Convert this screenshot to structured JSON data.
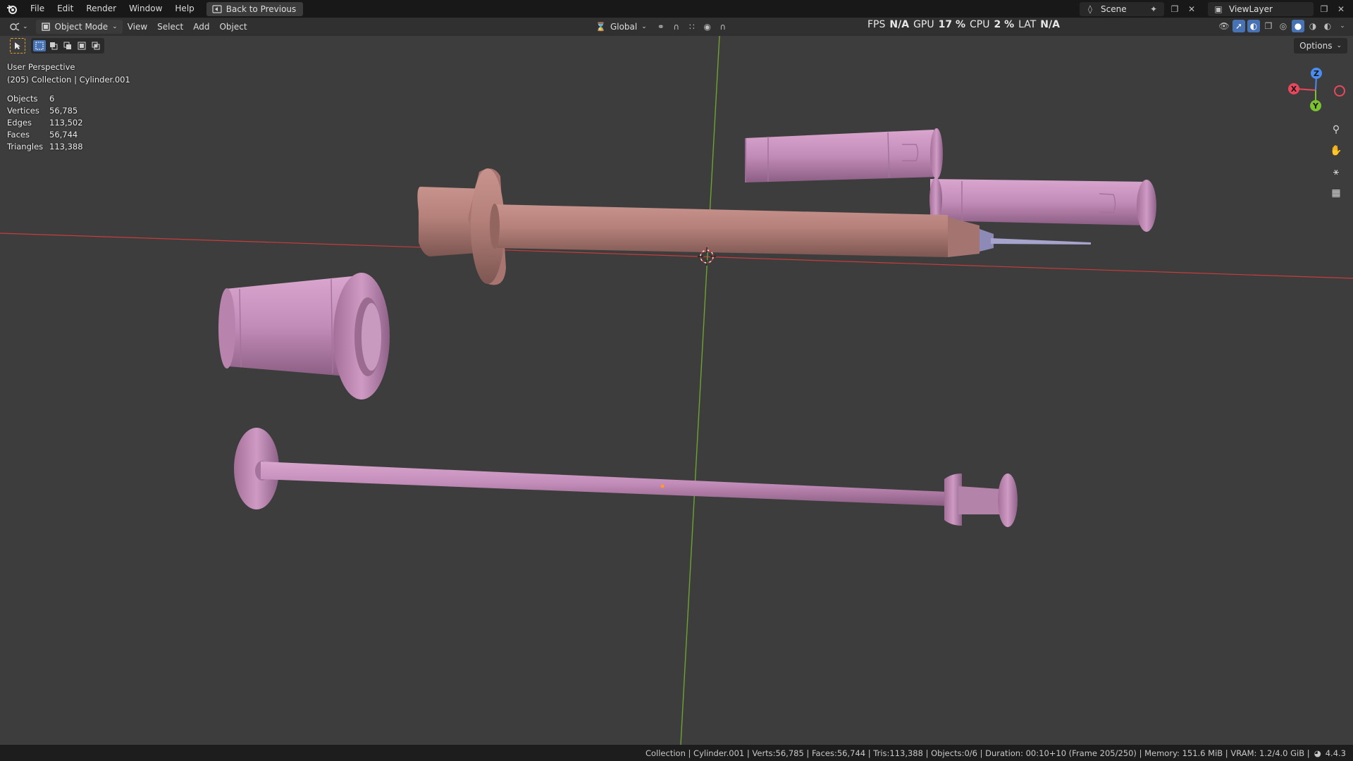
{
  "menubar": {
    "items": [
      "File",
      "Edit",
      "Render",
      "Window",
      "Help"
    ],
    "back_button": "Back to Previous",
    "scene_label": "Scene",
    "viewlayer_label": "ViewLayer"
  },
  "header": {
    "mode": "Object Mode",
    "menus": [
      "View",
      "Select",
      "Add",
      "Object"
    ],
    "orientation": "Global",
    "options": "Options"
  },
  "perf": {
    "fps_label": "FPS",
    "fps_value": "N/A",
    "gpu_label": "GPU",
    "gpu_value": "17 %",
    "cpu_label": "CPU",
    "cpu_value": "2 %",
    "lat_label": "LAT",
    "lat_value": "N/A"
  },
  "overlay": {
    "view_name": "User Perspective",
    "context": "(205) Collection | Cylinder.001"
  },
  "stats": [
    {
      "key": "Objects",
      "value": "6"
    },
    {
      "key": "Vertices",
      "value": "56,785"
    },
    {
      "key": "Edges",
      "value": "113,502"
    },
    {
      "key": "Faces",
      "value": "56,744"
    },
    {
      "key": "Triangles",
      "value": "113,388"
    }
  ],
  "gizmo": {
    "x": "X",
    "y": "Y",
    "z": "Z"
  },
  "statusbar": {
    "text": "Collection | Cylinder.001 | Verts:56,785 | Faces:56,744 | Tris:113,388 | Objects:0/6 | Duration: 00:10+10 (Frame 205/250) | Memory: 151.6 MiB | VRAM: 1.2/4.0 GiB |",
    "version": "4.4.3"
  },
  "colors": {
    "viewport_bg": "#3d3d3d",
    "x_axis": "#c83c3c",
    "y_axis": "#6ea332",
    "barrel": "#b07f7a",
    "plastic": "#c28cb8"
  }
}
